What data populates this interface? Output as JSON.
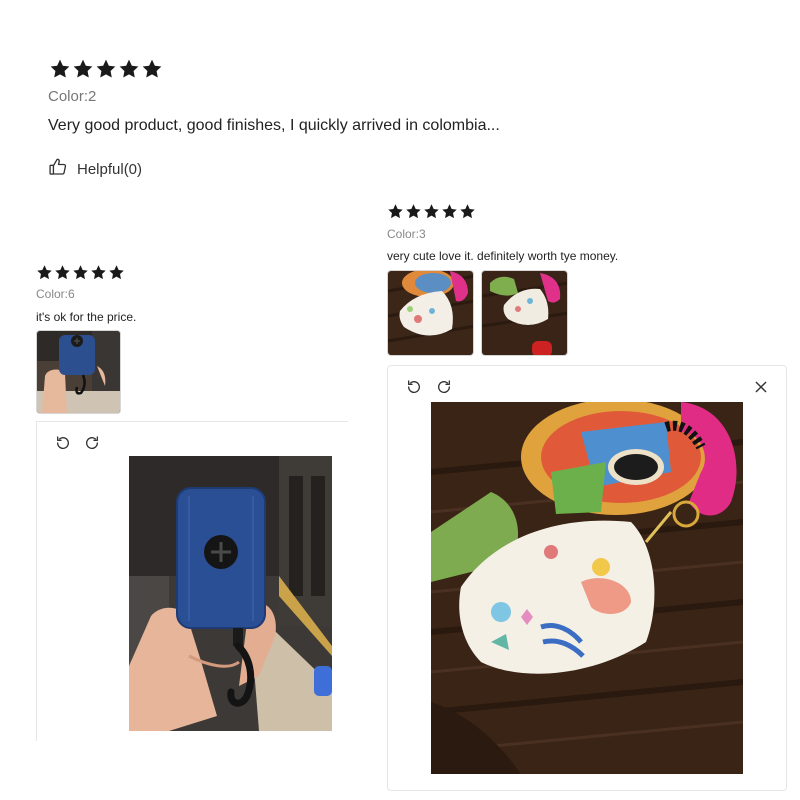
{
  "reviews": [
    {
      "rating": 5,
      "color_label": "Color:2",
      "text": "Very good product, good finishes, I quickly arrived in colombia...",
      "helpful_label": "Helpful(0)"
    },
    {
      "rating": 5,
      "color_label": "Color:6",
      "text": "it's ok for the price."
    },
    {
      "rating": 5,
      "color_label": "Color:3",
      "text": "very cute love it. definitely worth tye money."
    }
  ],
  "icons": {
    "star": "star-icon",
    "helpful": "thumbs-up-icon",
    "rotate_left": "rotate-left-icon",
    "rotate_right": "rotate-right-icon",
    "close": "close-icon"
  },
  "colors": {
    "star": "#1a1a1a",
    "muted_text": "#888888",
    "border": "#e6e6e6"
  }
}
